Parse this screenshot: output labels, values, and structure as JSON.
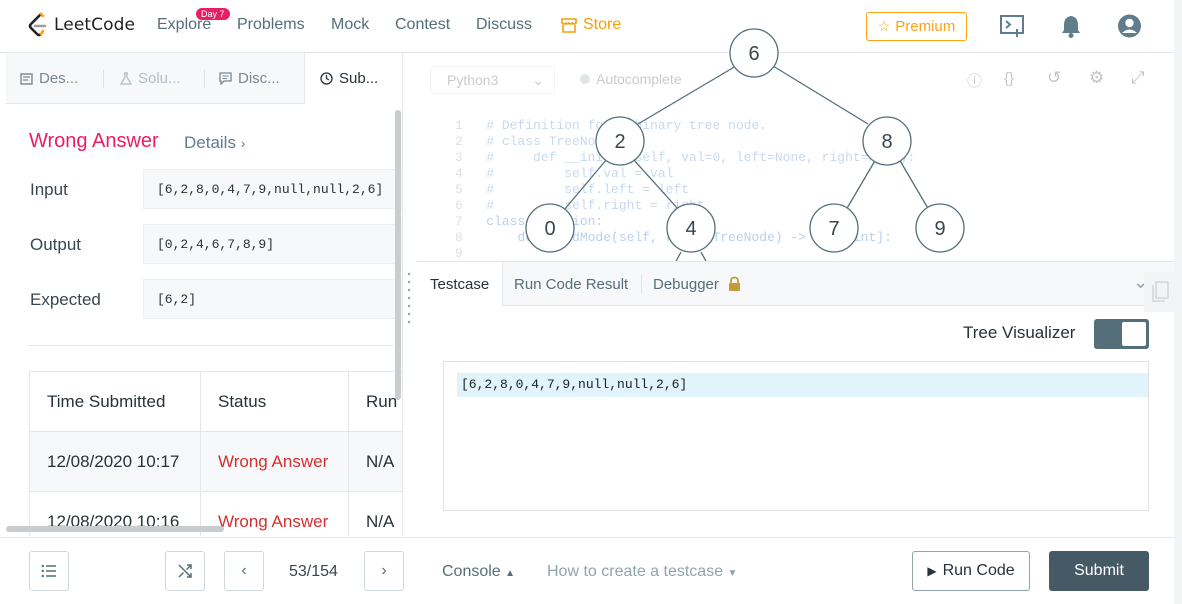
{
  "nav": {
    "logo": "LeetCode",
    "items": [
      "Explore",
      "Problems",
      "Mock",
      "Contest",
      "Discuss"
    ],
    "store": "Store",
    "badge": "Day 7",
    "premium": "Premium"
  },
  "left_tabs": [
    "Des...",
    "Solu...",
    "Disc...",
    "Sub..."
  ],
  "result": {
    "status": "Wrong Answer",
    "details": "Details",
    "input_label": "Input",
    "input": "[6,2,8,0,4,7,9,null,null,2,6]",
    "output_label": "Output",
    "output": "[0,2,4,6,7,8,9]",
    "expected_label": "Expected",
    "expected": "[6,2]"
  },
  "submissions": {
    "headers": [
      "Time Submitted",
      "Status",
      "Run"
    ],
    "rows": [
      {
        "time": "12/08/2020 10:17",
        "status": "Wrong Answer",
        "runtime": "N/A"
      },
      {
        "time": "12/08/2020 10:16",
        "status": "Wrong Answer",
        "runtime": "N/A"
      }
    ]
  },
  "editor": {
    "language": "Python3",
    "autocomplete": "Autocomplete",
    "lines": [
      {
        "n": "1",
        "text": "# Definition for a binary tree node."
      },
      {
        "n": "2",
        "text": "# class TreeNode:"
      },
      {
        "n": "3",
        "text": "#     def __init__(self, val=0, left=None, right=None):"
      },
      {
        "n": "4",
        "text": "#         self.val = val"
      },
      {
        "n": "5",
        "text": "#         self.left = left"
      },
      {
        "n": "6",
        "text": "#         self.right = right"
      },
      {
        "n": "7",
        "text": "class Solution:"
      },
      {
        "n": "8",
        "text": "    def findMode(self, root: TreeNode) -> List[int]:"
      },
      {
        "n": "9",
        "text": ""
      }
    ]
  },
  "tree": {
    "nodes": [
      "6",
      "2",
      "8",
      "0",
      "4",
      "7",
      "9"
    ]
  },
  "console": {
    "tabs": [
      "Testcase",
      "Run Code Result",
      "Debugger"
    ],
    "tree_visualizer": "Tree Visualizer",
    "testcase": "[6,2,8,0,4,7,9,null,null,2,6]"
  },
  "footer": {
    "pager": "53/154",
    "console": "Console",
    "howto": "How to create a testcase",
    "run": "Run Code",
    "submit": "Submit"
  }
}
